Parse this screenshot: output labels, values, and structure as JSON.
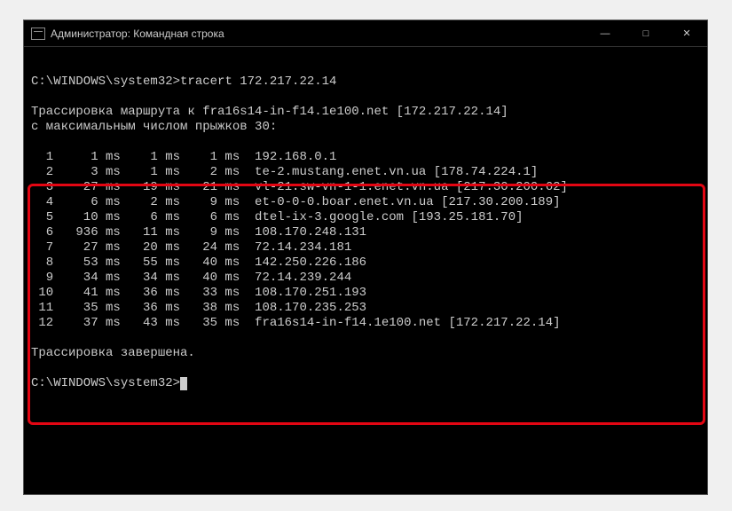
{
  "titlebar": {
    "title": "Администратор: Командная строка",
    "minimize": "—",
    "maximize": "□",
    "close": "✕"
  },
  "terminal": {
    "prompt1": "C:\\WINDOWS\\system32>",
    "command": "tracert 172.217.22.14",
    "trace_header_line1": "Трассировка маршрута к fra16s14-in-f14.1e100.net [172.217.22.14]",
    "trace_header_line2": "с максимальным числом прыжков 30:",
    "hops": [
      {
        "n": 1,
        "t1": "1 ms",
        "t2": "1 ms",
        "t3": "1 ms",
        "host": "192.168.0.1"
      },
      {
        "n": 2,
        "t1": "3 ms",
        "t2": "1 ms",
        "t3": "2 ms",
        "host": "te-2.mustang.enet.vn.ua [178.74.224.1]"
      },
      {
        "n": 3,
        "t1": "27 ms",
        "t2": "19 ms",
        "t3": "21 ms",
        "host": "vl-21.sw-vn-1-1.enet.vn.ua [217.30.200.62]"
      },
      {
        "n": 4,
        "t1": "6 ms",
        "t2": "2 ms",
        "t3": "9 ms",
        "host": "et-0-0-0.boar.enet.vn.ua [217.30.200.189]"
      },
      {
        "n": 5,
        "t1": "10 ms",
        "t2": "6 ms",
        "t3": "6 ms",
        "host": "dtel-ix-3.google.com [193.25.181.70]"
      },
      {
        "n": 6,
        "t1": "936 ms",
        "t2": "11 ms",
        "t3": "9 ms",
        "host": "108.170.248.131"
      },
      {
        "n": 7,
        "t1": "27 ms",
        "t2": "20 ms",
        "t3": "24 ms",
        "host": "72.14.234.181"
      },
      {
        "n": 8,
        "t1": "53 ms",
        "t2": "55 ms",
        "t3": "40 ms",
        "host": "142.250.226.186"
      },
      {
        "n": 9,
        "t1": "34 ms",
        "t2": "34 ms",
        "t3": "40 ms",
        "host": "72.14.239.244"
      },
      {
        "n": 10,
        "t1": "41 ms",
        "t2": "36 ms",
        "t3": "33 ms",
        "host": "108.170.251.193"
      },
      {
        "n": 11,
        "t1": "35 ms",
        "t2": "36 ms",
        "t3": "38 ms",
        "host": "108.170.235.253"
      },
      {
        "n": 12,
        "t1": "37 ms",
        "t2": "43 ms",
        "t3": "35 ms",
        "host": "fra16s14-in-f14.1e100.net [172.217.22.14]"
      }
    ],
    "trace_complete": "Трассировка завершена.",
    "prompt2": "C:\\WINDOWS\\system32>"
  }
}
